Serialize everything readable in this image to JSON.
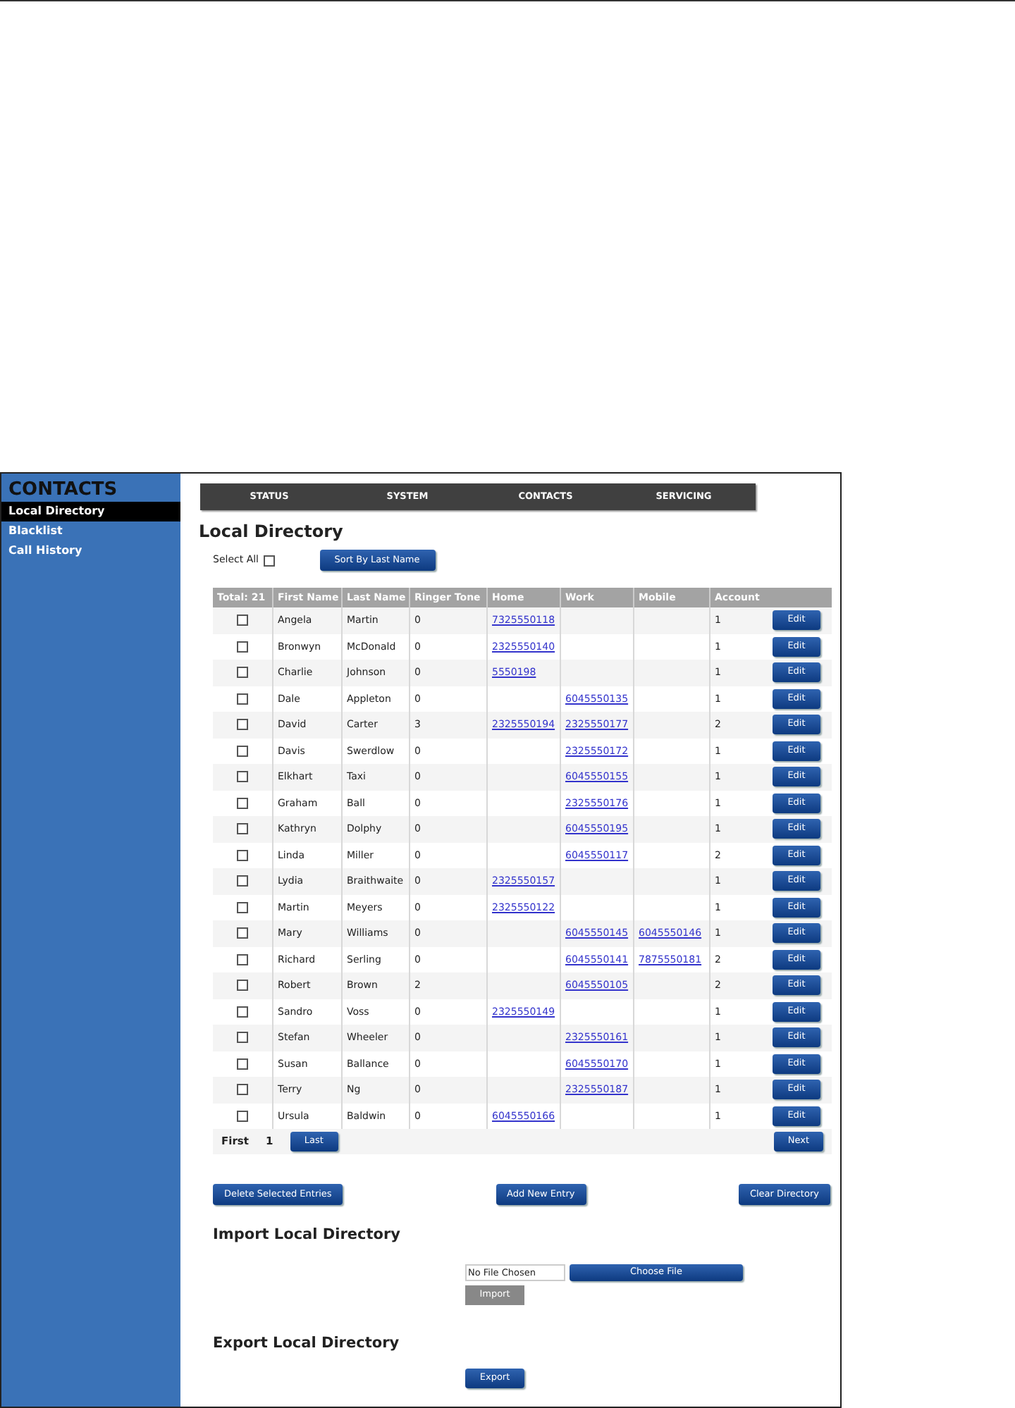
{
  "sidebar": {
    "title": "CONTACTS",
    "items": [
      {
        "label": "Local Directory",
        "selected": true
      },
      {
        "label": "Blacklist",
        "selected": false
      },
      {
        "label": "Call History",
        "selected": false
      }
    ]
  },
  "nav": [
    "STATUS",
    "SYSTEM",
    "CONTACTS",
    "SERVICING"
  ],
  "heading": "Local Directory",
  "select_all": {
    "label": "Select All",
    "checked": false
  },
  "sort_button": "Sort By Last Name",
  "table": {
    "columns": [
      "Total: 21",
      "First Name",
      "Last Name",
      "Ringer Tone",
      "Home",
      "Work",
      "Mobile",
      "Account"
    ],
    "rows": [
      {
        "checked": false,
        "first": "Angela",
        "last": "Martin",
        "ringer": "0",
        "home": "7325550118",
        "work": "",
        "mobile": "",
        "account": "1",
        "action": "Edit"
      },
      {
        "checked": false,
        "first": "Bronwyn",
        "last": "McDonald",
        "ringer": "0",
        "home": "2325550140",
        "work": "",
        "mobile": "",
        "account": "1",
        "action": "Edit"
      },
      {
        "checked": false,
        "first": "Charlie",
        "last": "Johnson",
        "ringer": "0",
        "home": "5550198",
        "work": "",
        "mobile": "",
        "account": "1",
        "action": "Edit"
      },
      {
        "checked": false,
        "first": "Dale",
        "last": "Appleton",
        "ringer": "0",
        "home": "",
        "work": "6045550135",
        "mobile": "",
        "account": "1",
        "action": "Edit"
      },
      {
        "checked": false,
        "first": "David",
        "last": "Carter",
        "ringer": "3",
        "home": "2325550194",
        "work": "2325550177",
        "mobile": "",
        "account": "2",
        "action": "Edit"
      },
      {
        "checked": false,
        "first": "Davis",
        "last": "Swerdlow",
        "ringer": "0",
        "home": "",
        "work": "2325550172",
        "mobile": "",
        "account": "1",
        "action": "Edit"
      },
      {
        "checked": false,
        "first": "Elkhart",
        "last": "Taxi",
        "ringer": "0",
        "home": "",
        "work": "6045550155",
        "mobile": "",
        "account": "1",
        "action": "Edit"
      },
      {
        "checked": false,
        "first": "Graham",
        "last": "Ball",
        "ringer": "0",
        "home": "",
        "work": "2325550176",
        "mobile": "",
        "account": "1",
        "action": "Edit"
      },
      {
        "checked": false,
        "first": "Kathryn",
        "last": "Dolphy",
        "ringer": "0",
        "home": "",
        "work": "6045550195",
        "mobile": "",
        "account": "1",
        "action": "Edit"
      },
      {
        "checked": false,
        "first": "Linda",
        "last": "Miller",
        "ringer": "0",
        "home": "",
        "work": "6045550117",
        "mobile": "",
        "account": "2",
        "action": "Edit"
      },
      {
        "checked": false,
        "first": "Lydia",
        "last": "Braithwaite",
        "ringer": "0",
        "home": "2325550157",
        "work": "",
        "mobile": "",
        "account": "1",
        "action": "Edit"
      },
      {
        "checked": false,
        "first": "Martin",
        "last": "Meyers",
        "ringer": "0",
        "home": "2325550122",
        "work": "",
        "mobile": "",
        "account": "1",
        "action": "Edit"
      },
      {
        "checked": false,
        "first": "Mary",
        "last": "Williams",
        "ringer": "0",
        "home": "",
        "work": "6045550145",
        "mobile": "6045550146",
        "account": "1",
        "action": "Edit"
      },
      {
        "checked": false,
        "first": "Richard",
        "last": "Serling",
        "ringer": "0",
        "home": "",
        "work": "6045550141",
        "mobile": "7875550181",
        "account": "2",
        "action": "Edit"
      },
      {
        "checked": false,
        "first": "Robert",
        "last": "Brown",
        "ringer": "2",
        "home": "",
        "work": "6045550105",
        "mobile": "",
        "account": "2",
        "action": "Edit"
      },
      {
        "checked": false,
        "first": "Sandro",
        "last": "Voss",
        "ringer": "0",
        "home": "2325550149",
        "work": "",
        "mobile": "",
        "account": "1",
        "action": "Edit"
      },
      {
        "checked": false,
        "first": "Stefan",
        "last": "Wheeler",
        "ringer": "0",
        "home": "",
        "work": "2325550161",
        "mobile": "",
        "account": "1",
        "action": "Edit"
      },
      {
        "checked": false,
        "first": "Susan",
        "last": "Ballance",
        "ringer": "0",
        "home": "",
        "work": "6045550170",
        "mobile": "",
        "account": "1",
        "action": "Edit"
      },
      {
        "checked": false,
        "first": "Terry",
        "last": "Ng",
        "ringer": "0",
        "home": "",
        "work": "2325550187",
        "mobile": "",
        "account": "1",
        "action": "Edit"
      },
      {
        "checked": false,
        "first": "Ursula",
        "last": "Baldwin",
        "ringer": "0",
        "home": "6045550166",
        "work": "",
        "mobile": "",
        "account": "1",
        "action": "Edit"
      }
    ]
  },
  "pagination": {
    "first": "First",
    "page": "1",
    "last": "Last",
    "next": "Next"
  },
  "actions": [
    "Delete Selected Entries",
    "Add New Entry",
    "Clear Directory"
  ],
  "import": {
    "heading": "Import Local Directory",
    "file_value": "No File Chosen",
    "choose": "Choose File",
    "import": "Import"
  },
  "export": {
    "heading": "Export Local Directory",
    "button": "Export"
  }
}
